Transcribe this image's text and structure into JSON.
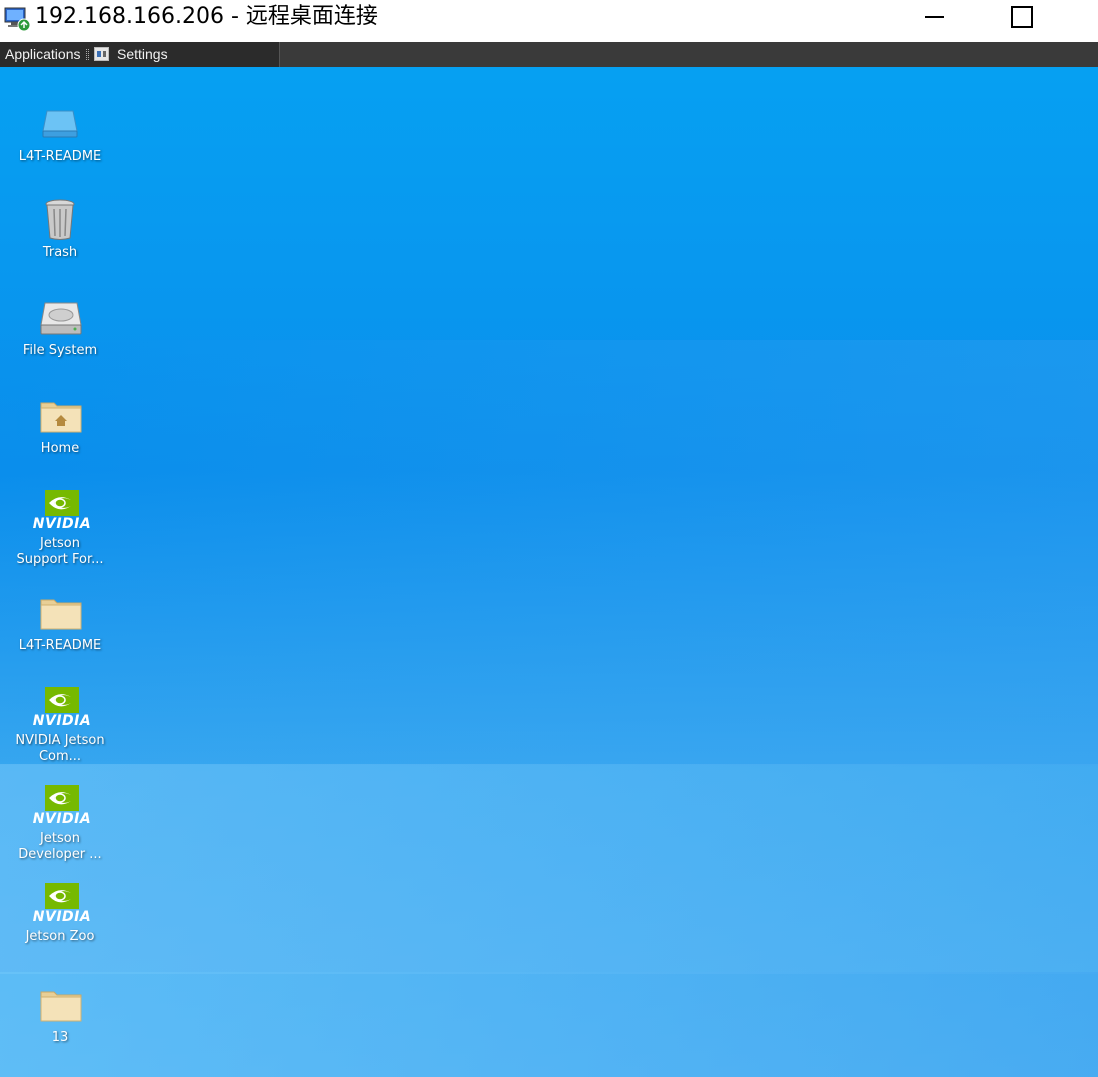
{
  "window": {
    "title": "192.168.166.206 - 远程桌面连接"
  },
  "panel": {
    "applications_label": "Applications",
    "settings_label": "Settings"
  },
  "desktop": {
    "icons": [
      {
        "label": "L4T-README",
        "icon": "drive-icon"
      },
      {
        "label": "Trash",
        "icon": "trash-icon"
      },
      {
        "label": "File System",
        "icon": "hard-disk-icon"
      },
      {
        "label": "Home",
        "icon": "home-folder-icon"
      },
      {
        "label": "Jetson Support For...",
        "icon": "nvidia-icon",
        "brand": "NVIDIA"
      },
      {
        "label": "L4T-README",
        "icon": "folder-icon"
      },
      {
        "label": "NVIDIA Jetson Com...",
        "icon": "nvidia-icon",
        "brand": "NVIDIA"
      },
      {
        "label": "Jetson Developer ...",
        "icon": "nvidia-icon",
        "brand": "NVIDIA"
      },
      {
        "label": "Jetson Zoo",
        "icon": "nvidia-icon",
        "brand": "NVIDIA"
      },
      {
        "label": "13",
        "icon": "folder-icon"
      }
    ]
  },
  "colors": {
    "panel_bg": "#3a3a3a",
    "desktop_top": "#06a0f2",
    "desktop_bottom": "#4db0f2",
    "nvidia_green": "#76b900",
    "folder_tan": "#f2dfb4"
  }
}
